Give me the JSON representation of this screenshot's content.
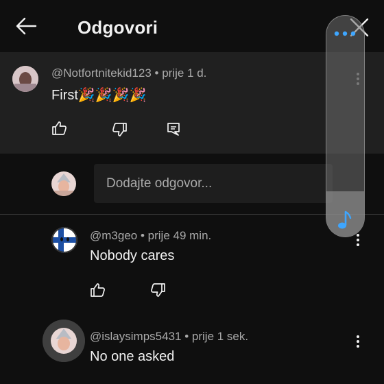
{
  "header": {
    "title": "Odgovori"
  },
  "parent_comment": {
    "author": "@Notfortnitekid123",
    "time": "• prije 1 d.",
    "text": "First🎉🎉🎉🎉"
  },
  "reply_box": {
    "placeholder": "Dodajte odgovor..."
  },
  "replies": [
    {
      "author": "@m3geo",
      "time": "• prije 49 min.",
      "text": "Nobody cares"
    },
    {
      "author": "@islaysimps5431",
      "time": "• prije 1 sek.",
      "text": "No one asked"
    }
  ],
  "colors": {
    "accent": "#3ea6ff",
    "background": "#0f0f0f",
    "parent_bg": "#202020"
  }
}
